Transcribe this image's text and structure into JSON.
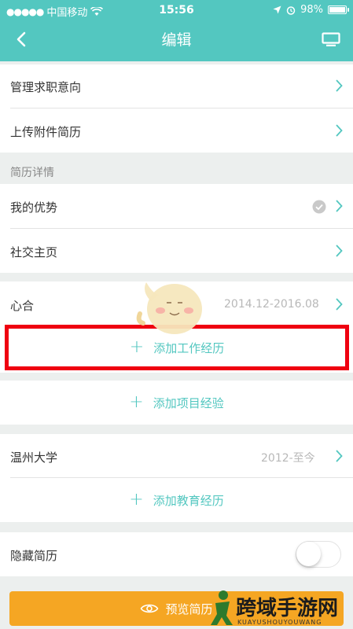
{
  "status_bar": {
    "carrier": "中国移动",
    "time": "15:56",
    "battery": "98%",
    "battery_level": 0.98
  },
  "nav": {
    "title": "编辑",
    "back_icon": "chevron-left-icon",
    "screen_icon": "monitor-icon"
  },
  "top_rows": [
    {
      "label": "管理求职意向"
    },
    {
      "label": "上传附件简历"
    }
  ],
  "resume_details": {
    "header": "简历详情",
    "rows": [
      {
        "label": "我的优势"
      },
      {
        "label": "社交主页"
      }
    ]
  },
  "work": {
    "company": "心合",
    "period": "2014.12-2016.08",
    "add_label": "添加工作经历"
  },
  "project": {
    "add_label": "添加项目经验"
  },
  "education": {
    "school": "温州大学",
    "period": "2012-至今",
    "add_label": "添加教育经历"
  },
  "hide_resume": {
    "label": "隐藏简历",
    "enabled": false
  },
  "preview": {
    "label": "预览简历"
  },
  "watermark": {
    "text": "跨域手游网",
    "subtext": "KUAYUSHOUYOUWANG"
  },
  "colors": {
    "accent": "#53c7c0",
    "highlight_box": "#ef0010",
    "preview_button": "#f5a623"
  }
}
